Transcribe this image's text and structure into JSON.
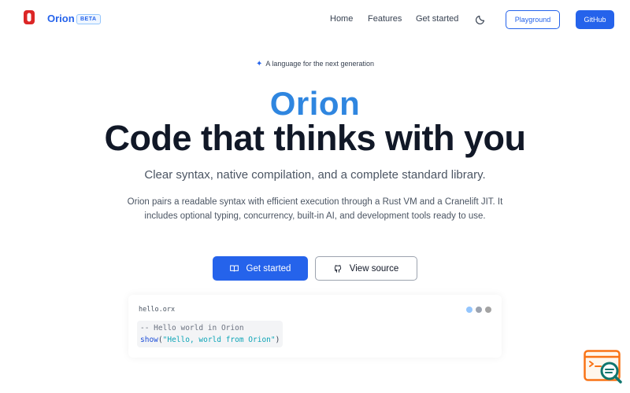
{
  "nav": {
    "brand": "Orion",
    "badge": "BETA",
    "links": [
      "Home",
      "Features",
      "Get started"
    ],
    "playground_label": "Playground",
    "github_label": "GitHub"
  },
  "hero": {
    "tagline": "A language for the next generation",
    "brand": "Orion",
    "title": "Code that thinks with you",
    "subtitle": "Clear syntax, native compilation, and a complete standard library.",
    "description": "Orion pairs a readable syntax with efficient execution through a Rust VM and a Cranelift JIT. It includes optional typing, concurrency, built-in AI, and development tools ready to use.",
    "primary_cta": "Get started",
    "secondary_cta": "View source"
  },
  "code": {
    "filename": "hello.orx",
    "comment": "-- Hello world in Orion",
    "fn": "show",
    "open": "(",
    "string": "\"Hello, world from Orion\"",
    "close": ")",
    "dot_colors": [
      "#93c5fd",
      "#9ca3af",
      "#a3a3a3"
    ]
  },
  "icons": {
    "logo": "orion-logo-icon",
    "theme": "moon-icon",
    "sparkle": "sparkle-icon",
    "book": "book-icon",
    "github": "github-icon",
    "widget": "search-feedback-icon"
  },
  "colors": {
    "accent": "#2563eb",
    "brand_gradient": "#2f86e0",
    "logo_red": "#dc2626"
  }
}
